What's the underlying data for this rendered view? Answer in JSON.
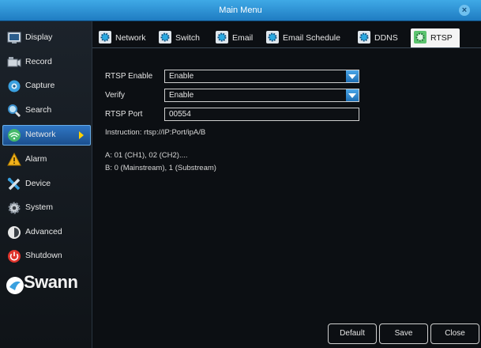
{
  "window": {
    "title": "Main Menu",
    "close": "×"
  },
  "sidebar": {
    "items": [
      {
        "label": "Display",
        "icon": "display-icon"
      },
      {
        "label": "Record",
        "icon": "record-icon"
      },
      {
        "label": "Capture",
        "icon": "capture-icon"
      },
      {
        "label": "Search",
        "icon": "search-icon"
      },
      {
        "label": "Network",
        "icon": "network-icon",
        "active": true
      },
      {
        "label": "Alarm",
        "icon": "alarm-icon"
      },
      {
        "label": "Device",
        "icon": "device-icon"
      },
      {
        "label": "System",
        "icon": "system-icon"
      },
      {
        "label": "Advanced",
        "icon": "advanced-icon"
      },
      {
        "label": "Shutdown",
        "icon": "shutdown-icon"
      }
    ],
    "logo": "Swann"
  },
  "tabs": [
    {
      "label": "Network"
    },
    {
      "label": "Switch"
    },
    {
      "label": "Email"
    },
    {
      "label": "Email Schedule"
    },
    {
      "label": "DDNS"
    },
    {
      "label": "RTSP",
      "active": true
    }
  ],
  "form": {
    "rtsp_enable": {
      "label": "RTSP Enable",
      "value": "Enable"
    },
    "verify": {
      "label": "Verify",
      "value": "Enable"
    },
    "rtsp_port": {
      "label": "RTSP Port",
      "value": "00554"
    }
  },
  "info": {
    "instruction": "Instruction:  rtsp://IP:Port/ipA/B",
    "line_a": "A: 01 (CH1), 02 (CH2)....",
    "line_b": "B: 0 (Mainstream), 1 (Substream)"
  },
  "buttons": {
    "default": "Default",
    "save": "Save",
    "close": "Close"
  },
  "colors": {
    "accent": "#1f7cc2",
    "active_nav": "#2f76c4",
    "tab_icon": "#2aa8e0"
  }
}
